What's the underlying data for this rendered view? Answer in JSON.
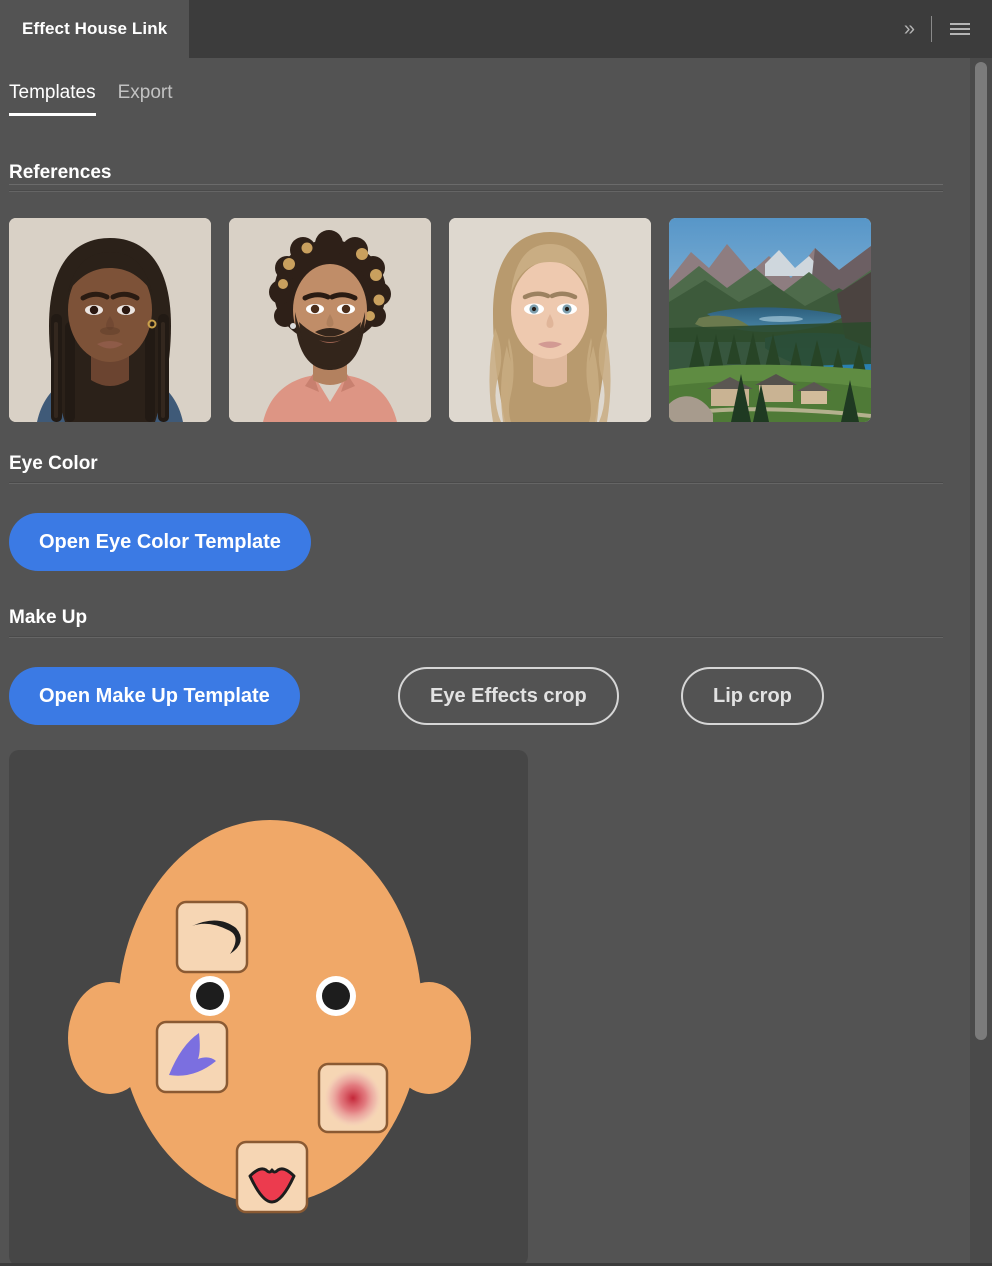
{
  "window": {
    "panel_tab_label": "Effect House Link",
    "collapse_icon": "chevron-double-right-icon",
    "collapse_glyph": "»",
    "menu_icon": "hamburger-menu-icon"
  },
  "tabs": [
    {
      "label": "Templates",
      "active": true
    },
    {
      "label": "Export",
      "active": false
    }
  ],
  "sections": {
    "references": {
      "title": "References",
      "thumbnails": [
        {
          "name": "portrait-woman-braids",
          "alt": "Portrait of woman with long braided hair",
          "kind": "portrait"
        },
        {
          "name": "portrait-man-curly-beard",
          "alt": "Portrait of bearded man with curly hair",
          "kind": "portrait"
        },
        {
          "name": "portrait-woman-blonde",
          "alt": "Portrait of blonde woman",
          "kind": "portrait"
        },
        {
          "name": "landscape-mountain-lake",
          "alt": "Mountain lake landscape with chalets",
          "kind": "landscape"
        }
      ]
    },
    "eye_color": {
      "title": "Eye Color",
      "primary_button": "Open Eye Color Template"
    },
    "make_up": {
      "title": "Make Up",
      "primary_button": "Open Make Up Template",
      "outline_buttons": [
        "Eye Effects crop",
        "Lip crop"
      ]
    }
  },
  "face_diagram": {
    "name": "makeup-face-diagram",
    "tiles": [
      {
        "name": "eyebrow-swatch",
        "label": "eyebrow"
      },
      {
        "name": "eyeshadow-swatch",
        "label": "eyeshadow"
      },
      {
        "name": "blush-swatch",
        "label": "blush"
      },
      {
        "name": "lips-swatch",
        "label": "lips"
      }
    ]
  },
  "colors": {
    "panel_bg": "#535353",
    "titlebar_bg": "#3c3c3c",
    "accent_blue": "#3b7ae4",
    "text_primary": "#ffffff",
    "text_muted": "#c2c2c2",
    "face_skin": "#f0a868",
    "swatch_bg": "#f6d6b4",
    "eyeshadow_purple": "#7b6fe0",
    "lips_red": "#ec3b4e",
    "blush_red": "#d4394b",
    "diagram_bg": "#464646"
  }
}
